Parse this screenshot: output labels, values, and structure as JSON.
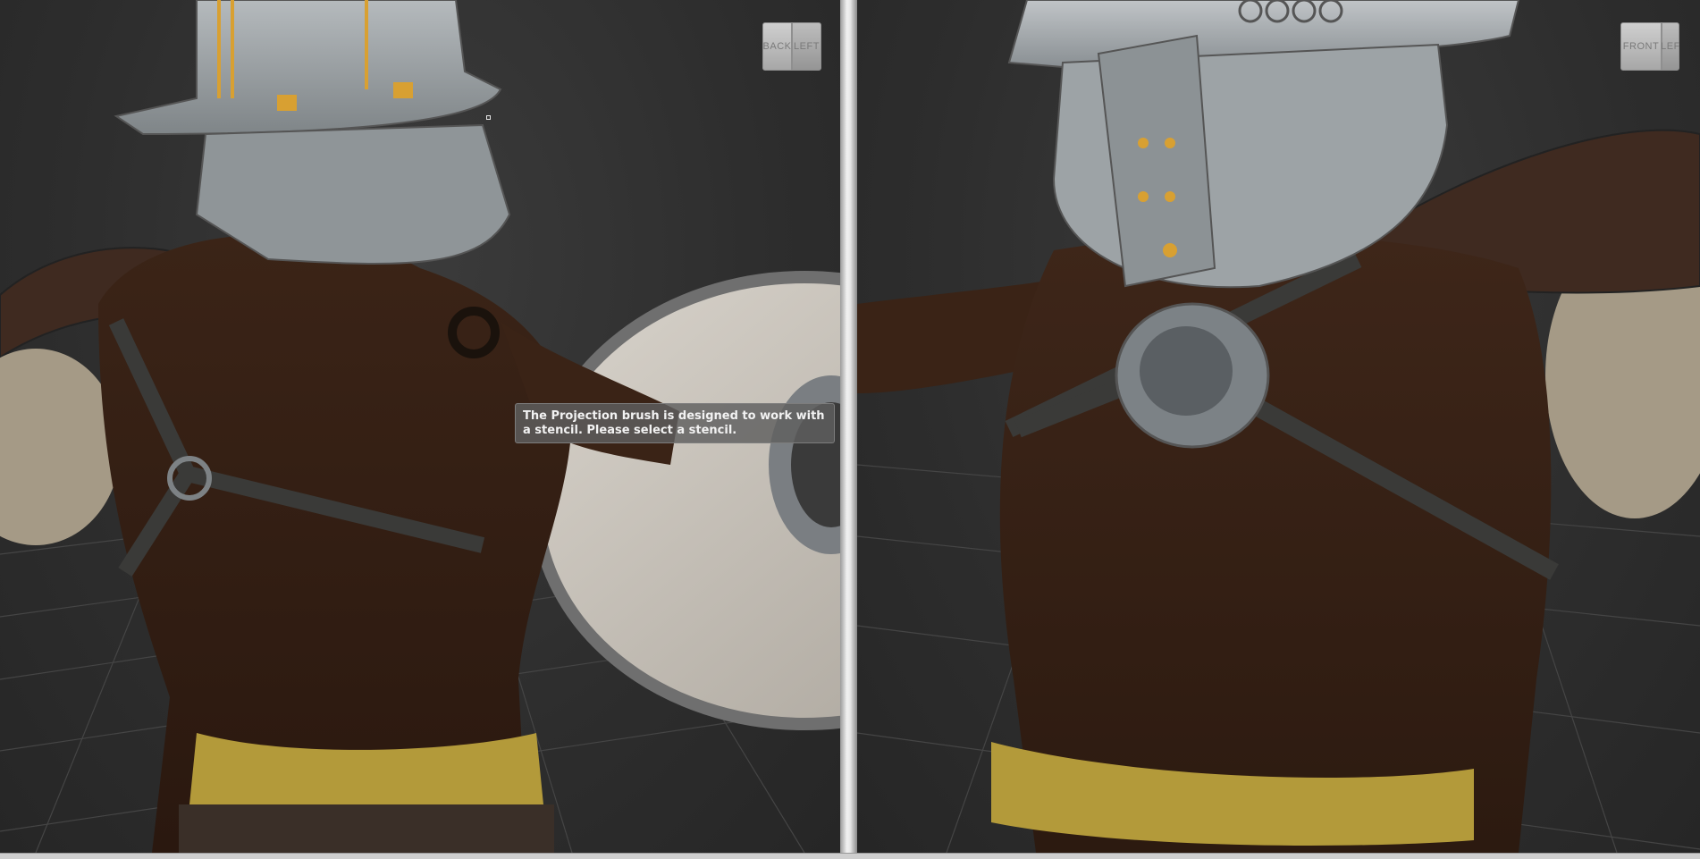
{
  "viewports": {
    "left": {
      "viewcube": {
        "face_a": "BACK",
        "face_b": "LEFT"
      }
    },
    "right": {
      "viewcube": {
        "face_a": "FRONT",
        "face_b": "LEF"
      }
    }
  },
  "tooltip": {
    "message": "The Projection brush is designed to work with a stencil. Please select a stencil."
  },
  "colors": {
    "viewport_background": "#2d2d2d",
    "grid_lines": "#474747",
    "skin": "#3a2216",
    "metal": "#9aa0a4",
    "leather_belt": "#b39a3a",
    "wood_shield": "#c8c2b8"
  }
}
